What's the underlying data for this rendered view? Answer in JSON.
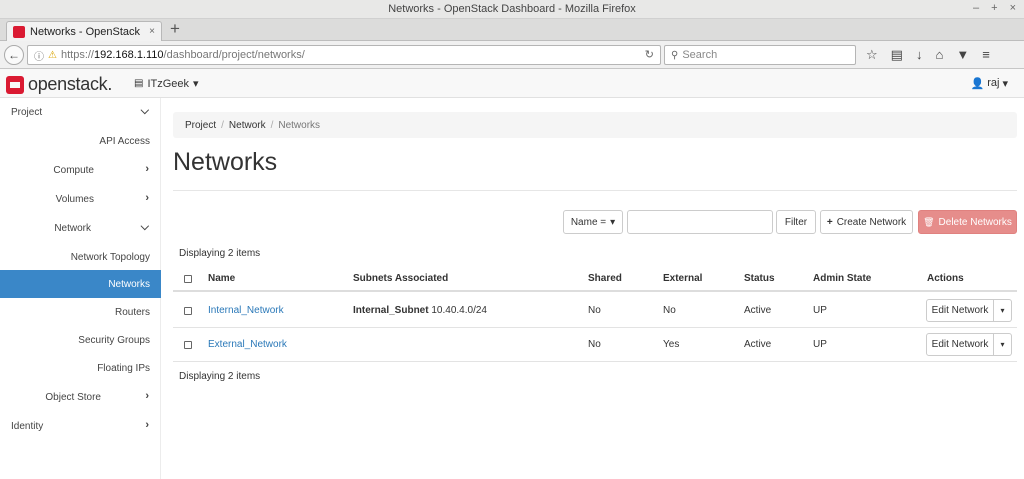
{
  "window": {
    "title": "Networks - OpenStack Dashboard - Mozilla Firefox",
    "minimize": "–",
    "maximize": "+",
    "close": "×"
  },
  "browser": {
    "tab_label": "Networks - OpenStack Dash",
    "tab_close": "×",
    "new_tab": "+",
    "back": "←",
    "url_prefix": "https://",
    "url_host": "192.168.1.110",
    "url_path": "/dashboard/project/networks/",
    "reload": "↻",
    "search_placeholder": "Search",
    "icons": [
      "star-icon",
      "reader-icon",
      "download-icon",
      "home-icon",
      "pocket-icon",
      "menu-icon"
    ],
    "icon_glyphs": [
      "☆",
      "▤",
      "↓",
      "⌂",
      "▼",
      "≡"
    ]
  },
  "header": {
    "brand": "openstack.",
    "project": "ITzGeek",
    "project_caret": "▾",
    "user": "raj",
    "user_caret": "▾"
  },
  "sidebar": {
    "items": [
      {
        "label": "Project",
        "chev": "⌵"
      },
      {
        "label": "API Access",
        "chev": ""
      },
      {
        "label": "Compute",
        "chev": "›"
      },
      {
        "label": "Volumes",
        "chev": "›"
      },
      {
        "label": "Network",
        "chev": "⌵"
      },
      {
        "label": "Network Topology",
        "chev": ""
      },
      {
        "label": "Networks",
        "chev": ""
      },
      {
        "label": "Routers",
        "chev": ""
      },
      {
        "label": "Security Groups",
        "chev": ""
      },
      {
        "label": "Floating IPs",
        "chev": ""
      },
      {
        "label": "Object Store",
        "chev": "›"
      },
      {
        "label": "Identity",
        "chev": "›"
      }
    ]
  },
  "breadcrumb": {
    "items": [
      "Project",
      "Network",
      "Networks"
    ],
    "separator": "/"
  },
  "page": {
    "title": "Networks"
  },
  "toolbar": {
    "filter_field": "Name =",
    "filter_caret": "▾",
    "filter_button": "Filter",
    "create_button": "Create Network",
    "create_icon": "+",
    "delete_button": "Delete Networks",
    "delete_icon": "🗑"
  },
  "table": {
    "displaying_top": "Displaying 2 items",
    "displaying_bottom": "Displaying 2 items",
    "columns": [
      "Name",
      "Subnets Associated",
      "Shared",
      "External",
      "Status",
      "Admin State",
      "Actions"
    ],
    "rows": [
      {
        "name": "Internal_Network",
        "subnet_name": "Internal_Subnet",
        "subnet_cidr": "10.40.4.0/24",
        "shared": "No",
        "external": "No",
        "status": "Active",
        "admin_state": "UP",
        "action": "Edit Network",
        "caret": "▾"
      },
      {
        "name": "External_Network",
        "subnet_name": "",
        "subnet_cidr": "",
        "shared": "No",
        "external": "Yes",
        "status": "Active",
        "admin_state": "UP",
        "action": "Edit Network",
        "caret": "▾"
      }
    ]
  },
  "colors": {
    "accent": "#3a87c8",
    "brand": "#da1a32",
    "danger": "#e68d8b",
    "link": "#2a78b8"
  }
}
